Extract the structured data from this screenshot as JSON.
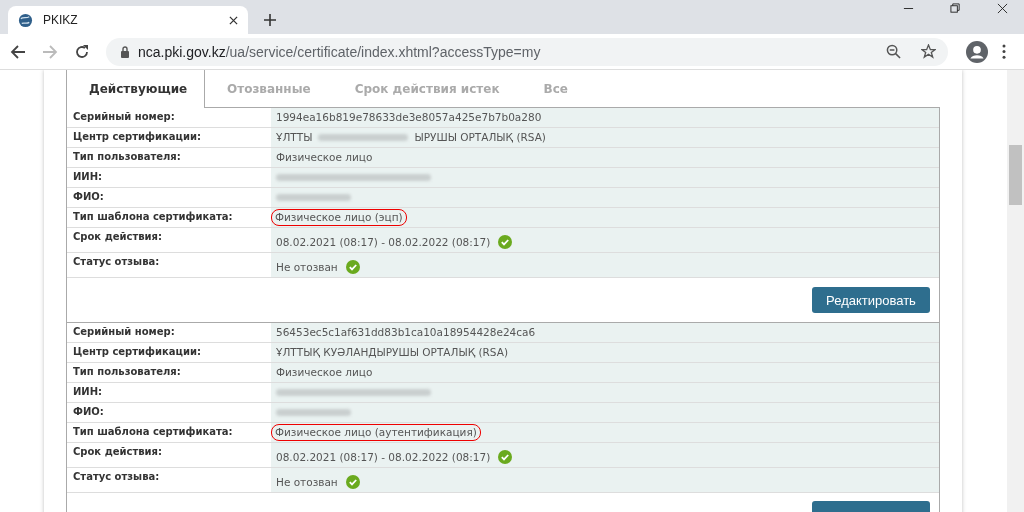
{
  "browser": {
    "tab_title": "PKIKZ",
    "url_host": "nca.pki.gov.kz",
    "url_path": "/ua/service/certificate/index.xhtml?accessType=my"
  },
  "tabs": [
    {
      "label": "Действующие",
      "selected": true
    },
    {
      "label": "Отозванные",
      "selected": false
    },
    {
      "label": "Срок действия истек",
      "selected": false
    },
    {
      "label": "Все",
      "selected": false
    }
  ],
  "certificates": [
    {
      "fields": [
        {
          "label": "Серийный номер:",
          "kind": "text",
          "value": "1994ea16b819e78633de3e8057a425e7b7b0a280"
        },
        {
          "label": "Центр сертификации:",
          "kind": "partial",
          "parts": [
            "ҰЛТТЫ",
            "ЫРУШЫ ОРТАЛЫҚ (RSA)"
          ]
        },
        {
          "label": "Тип пользователя:",
          "kind": "text",
          "value": "Физическое лицо"
        },
        {
          "label": "ИИН:",
          "kind": "redacted"
        },
        {
          "label": "ФИО:",
          "kind": "redacted"
        },
        {
          "label": "Тип шаблона сертификата:",
          "kind": "text",
          "value": "Физическое лицо (эцп)",
          "circled": true
        },
        {
          "label": "Срок действия:",
          "kind": "text",
          "value": "08.02.2021 (08:17) - 08.02.2022 (08:17)",
          "ok": true
        },
        {
          "label": "Статус отзыва:",
          "kind": "text",
          "value": "Не отозван",
          "ok": true
        }
      ],
      "button": "Редактировать"
    },
    {
      "fields": [
        {
          "label": "Серийный номер:",
          "kind": "text",
          "value": "56453ec5c1af631dd83b1ca10a18954428e24ca6"
        },
        {
          "label": "Центр сертификации:",
          "kind": "text",
          "value": "ҰЛТТЫҚ КУӘЛАНДЫРУШЫ ОРТАЛЫҚ (RSA)"
        },
        {
          "label": "Тип пользователя:",
          "kind": "text",
          "value": "Физическое лицо"
        },
        {
          "label": "ИИН:",
          "kind": "redacted"
        },
        {
          "label": "ФИО:",
          "kind": "redacted"
        },
        {
          "label": "Тип шаблона сертификата:",
          "kind": "text",
          "value": "Физическое лицо (аутентификация)",
          "circled": true
        },
        {
          "label": "Срок действия:",
          "kind": "text",
          "value": "08.02.2021 (08:17) - 08.02.2022 (08:17)",
          "ok": true
        },
        {
          "label": "Статус отзыва:",
          "kind": "text",
          "value": "Не отозван",
          "ok": true
        }
      ]
    }
  ]
}
